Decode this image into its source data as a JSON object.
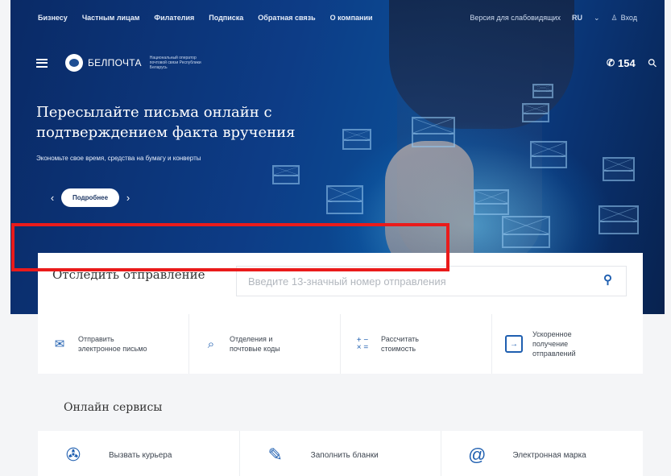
{
  "topbar": {
    "links": [
      "Бизнесу",
      "Частным лицам",
      "Филателия",
      "Подписка",
      "Обратная связь",
      "О компании"
    ],
    "accessibility": "Версия для слабовидящих",
    "lang": "RU",
    "login": "Вход"
  },
  "header": {
    "logo_name": "БЕЛПОЧТА",
    "logo_sub": "Национальный оператор почтовой связи Республики Беларусь",
    "phone": "154"
  },
  "hero": {
    "title": "Пересылайте письма онлайн с подтверждением факта вручения",
    "subtitle": "Экономьте свое время, средства на бумагу и конверты",
    "button": "Подробнее",
    "prev": "‹",
    "next": "›"
  },
  "track": {
    "title": "Отследить отправление",
    "placeholder": "Введите 13-значный номер отправления"
  },
  "quick": [
    {
      "label1": "Отправить",
      "label2": "электронное письмо",
      "label3": ""
    },
    {
      "label1": "Отделения и",
      "label2": "почтовые коды",
      "label3": ""
    },
    {
      "label1": "Рассчитать",
      "label2": "стоимость",
      "label3": ""
    },
    {
      "label1": "Ускоренное",
      "label2": "получение",
      "label3": "отправлений"
    }
  ],
  "online": {
    "title": "Онлайн сервисы",
    "items": [
      {
        "label": "Вызвать курьера"
      },
      {
        "label": "Заполнить бланки"
      },
      {
        "label": "Электронная марка"
      }
    ]
  },
  "colors": {
    "accent": "#1f5fb0",
    "highlight": "#ea1b1b"
  }
}
